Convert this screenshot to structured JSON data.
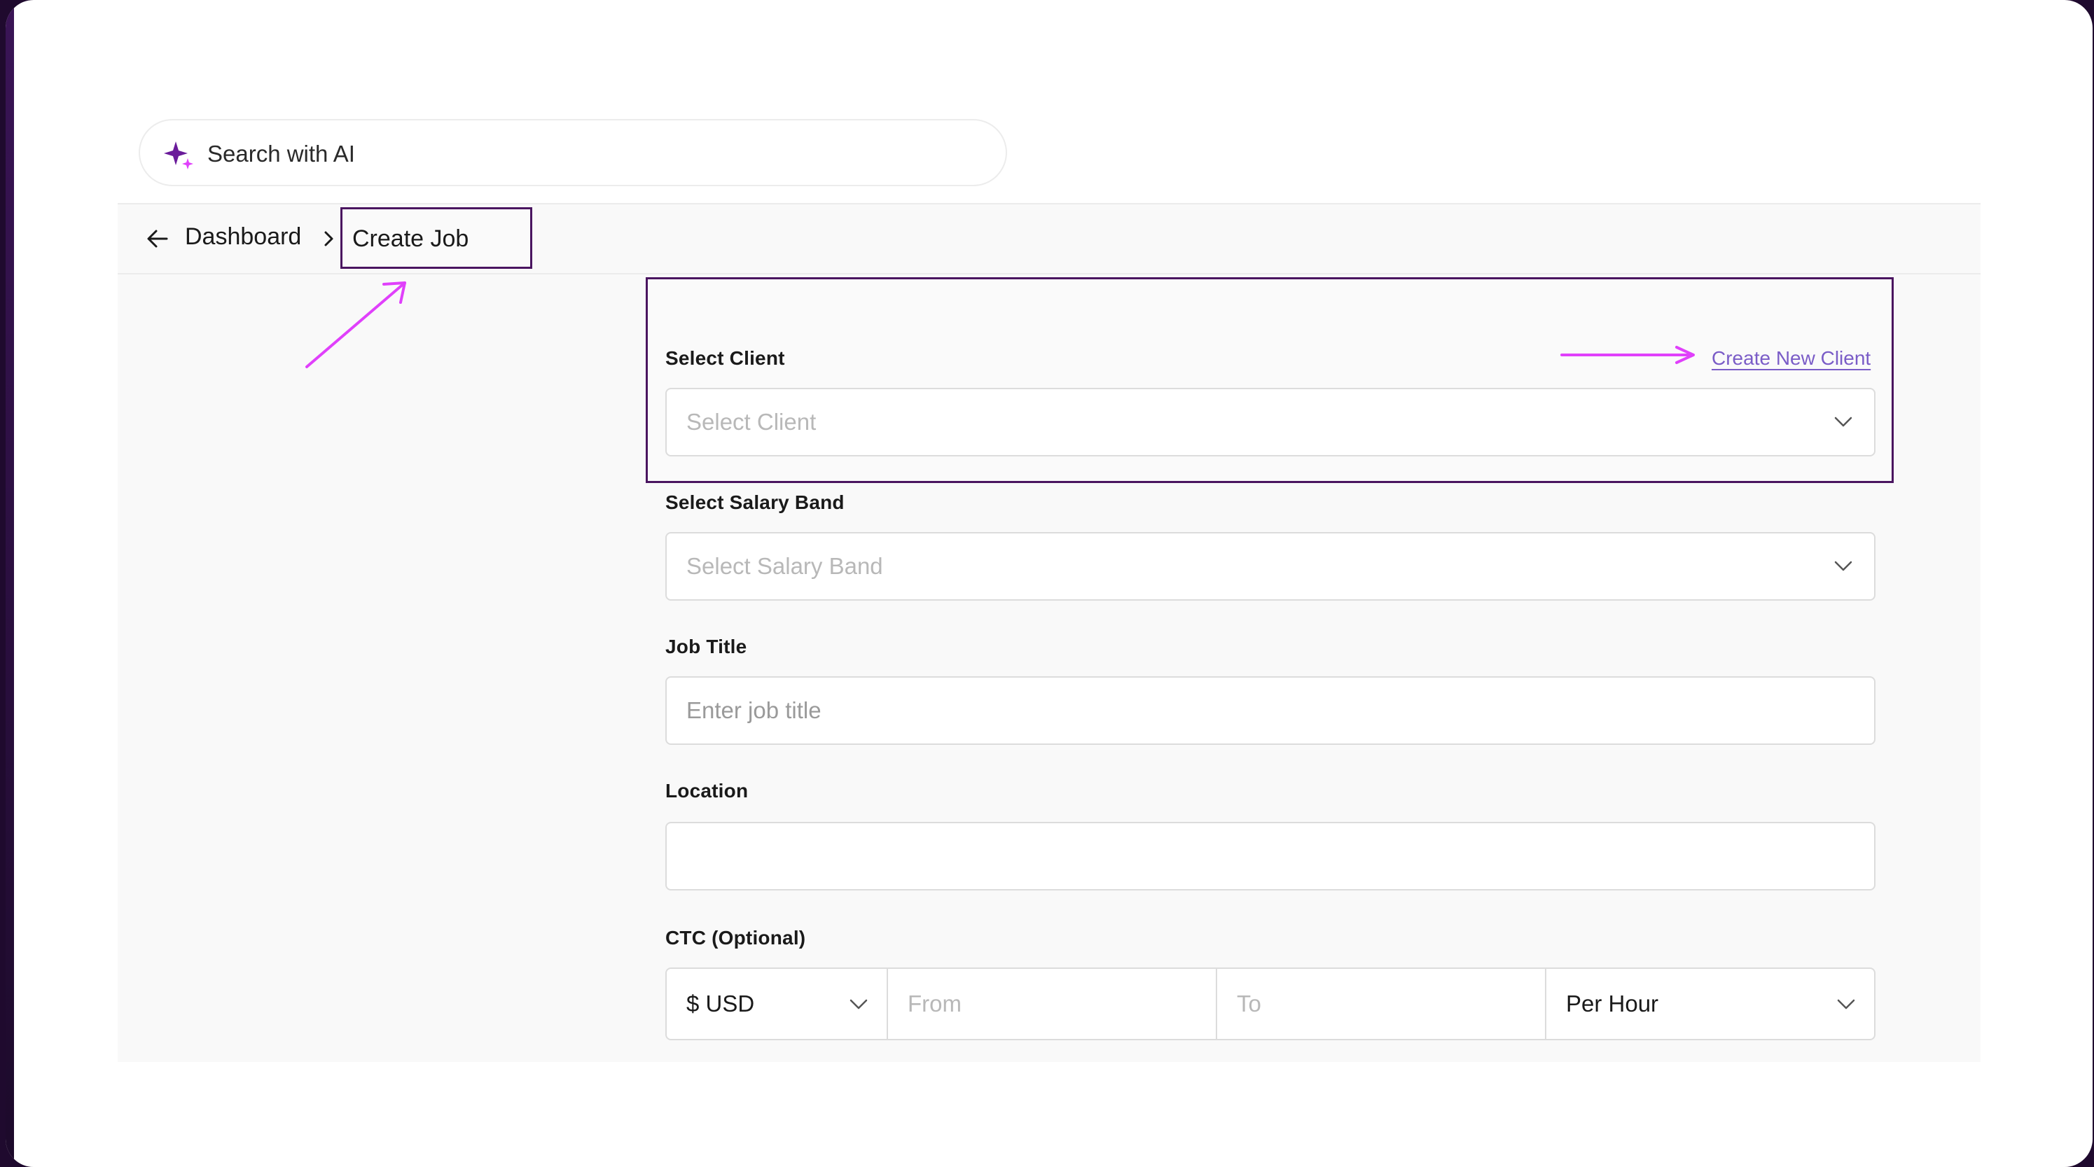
{
  "search": {
    "placeholder": "Search with AI"
  },
  "breadcrumb": {
    "parent": "Dashboard",
    "current": "Create Job"
  },
  "form": {
    "client": {
      "label": "Select Client",
      "placeholder": "Select Client",
      "create_link": "Create New Client"
    },
    "salary_band": {
      "label": "Select Salary Band",
      "placeholder": "Select Salary Band"
    },
    "job_title": {
      "label": "Job Title",
      "placeholder": "Enter job title"
    },
    "location": {
      "label": "Location",
      "value": ""
    },
    "ctc": {
      "label": "CTC (Optional)",
      "currency": "$ USD",
      "from_placeholder": "From",
      "to_placeholder": "To",
      "period": "Per Hour"
    }
  },
  "colors": {
    "accent": "#4a1560",
    "annotation": "#e040fb",
    "link": "#7a5cc7",
    "sparkle": "#6a1b9a"
  },
  "icons": [
    "sparkle-icon",
    "arrow-left-icon",
    "chevron-right-icon",
    "chevron-down-icon"
  ]
}
